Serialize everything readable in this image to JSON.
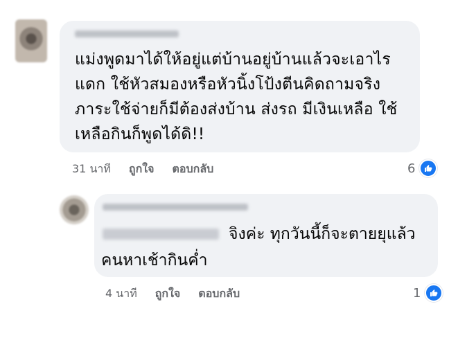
{
  "comment": {
    "text": "แม่งพูดมาได้ให้อยู่แต่บ้านอยู่บ้านแล้วจะเอาไร\nแดก  ใช้หัวสมองหรือหัวนิ้งโป้งตีนคิดถามจริง\nภาระใช้จ่ายก็มีต้องส่งบ้าน ส่งรถ มีเงินเหลือ ใช้\nเหลือกินก็พูดได้ดิ!!",
    "time": "31 นาที",
    "like_label": "ถูกใจ",
    "reply_label": "ตอบกลับ",
    "reactions": "6",
    "reaction_icon": "like-icon"
  },
  "reply": {
    "line1": "จิงค่ะ ทุกวันนี้ก็จะตายยุแล้ว",
    "line2": "คนหาเช้ากินค่ำ",
    "time": "4 นาที",
    "like_label": "ถูกใจ",
    "reply_label": "ตอบกลับ",
    "reactions": "1",
    "reaction_icon": "like-icon"
  },
  "colors": {
    "bubble": "#f0f2f5",
    "meta": "#65676b",
    "like": "#1877f2"
  }
}
